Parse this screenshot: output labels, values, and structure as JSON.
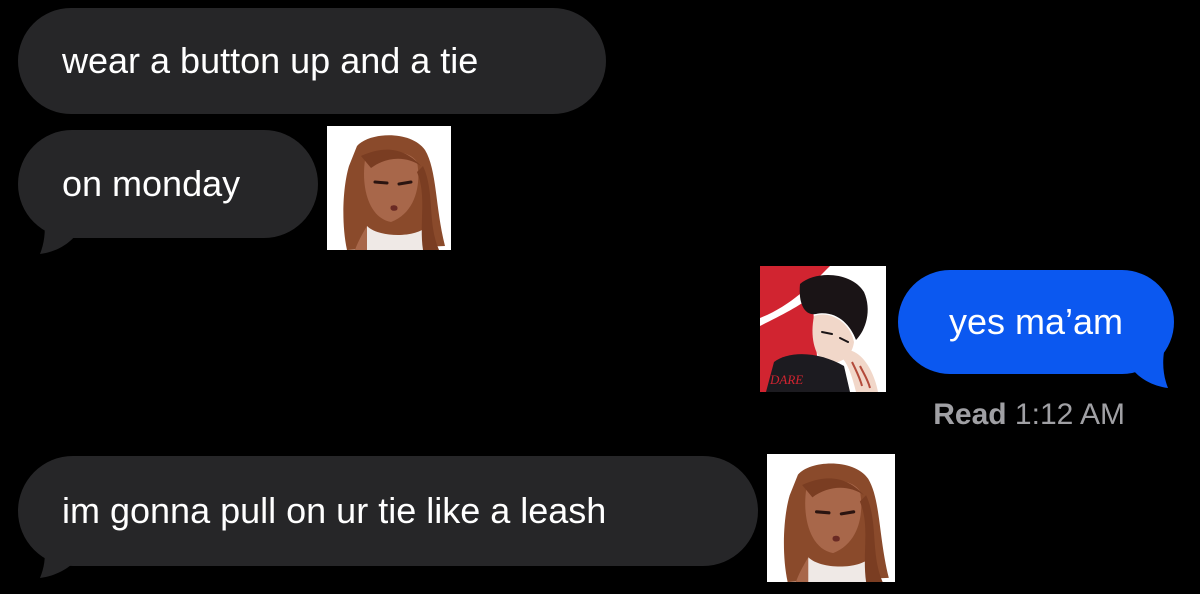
{
  "conversation": {
    "messages": [
      {
        "direction": "received",
        "text": "wear a button up and a tie"
      },
      {
        "direction": "received",
        "text": "on monday"
      },
      {
        "direction": "sent",
        "text": "yes ma’am"
      },
      {
        "direction": "received",
        "text": "im gonna pull on ur tie like a leash"
      }
    ],
    "read_receipt": {
      "label": "Read",
      "time": "1:12 AM"
    }
  },
  "sticker_text": {
    "shirt_print": "DARE"
  },
  "colors": {
    "background": "#000000",
    "received_bubble": "#262628",
    "sent_bubble": "#0b58f0",
    "bubble_text": "#ffffff",
    "receipt_text": "#a0a0a4"
  },
  "icons": {
    "sticker_1": "girl-avatar-sticker",
    "sticker_2": "boy-avatar-sticker",
    "sticker_3": "girl-avatar-sticker"
  }
}
